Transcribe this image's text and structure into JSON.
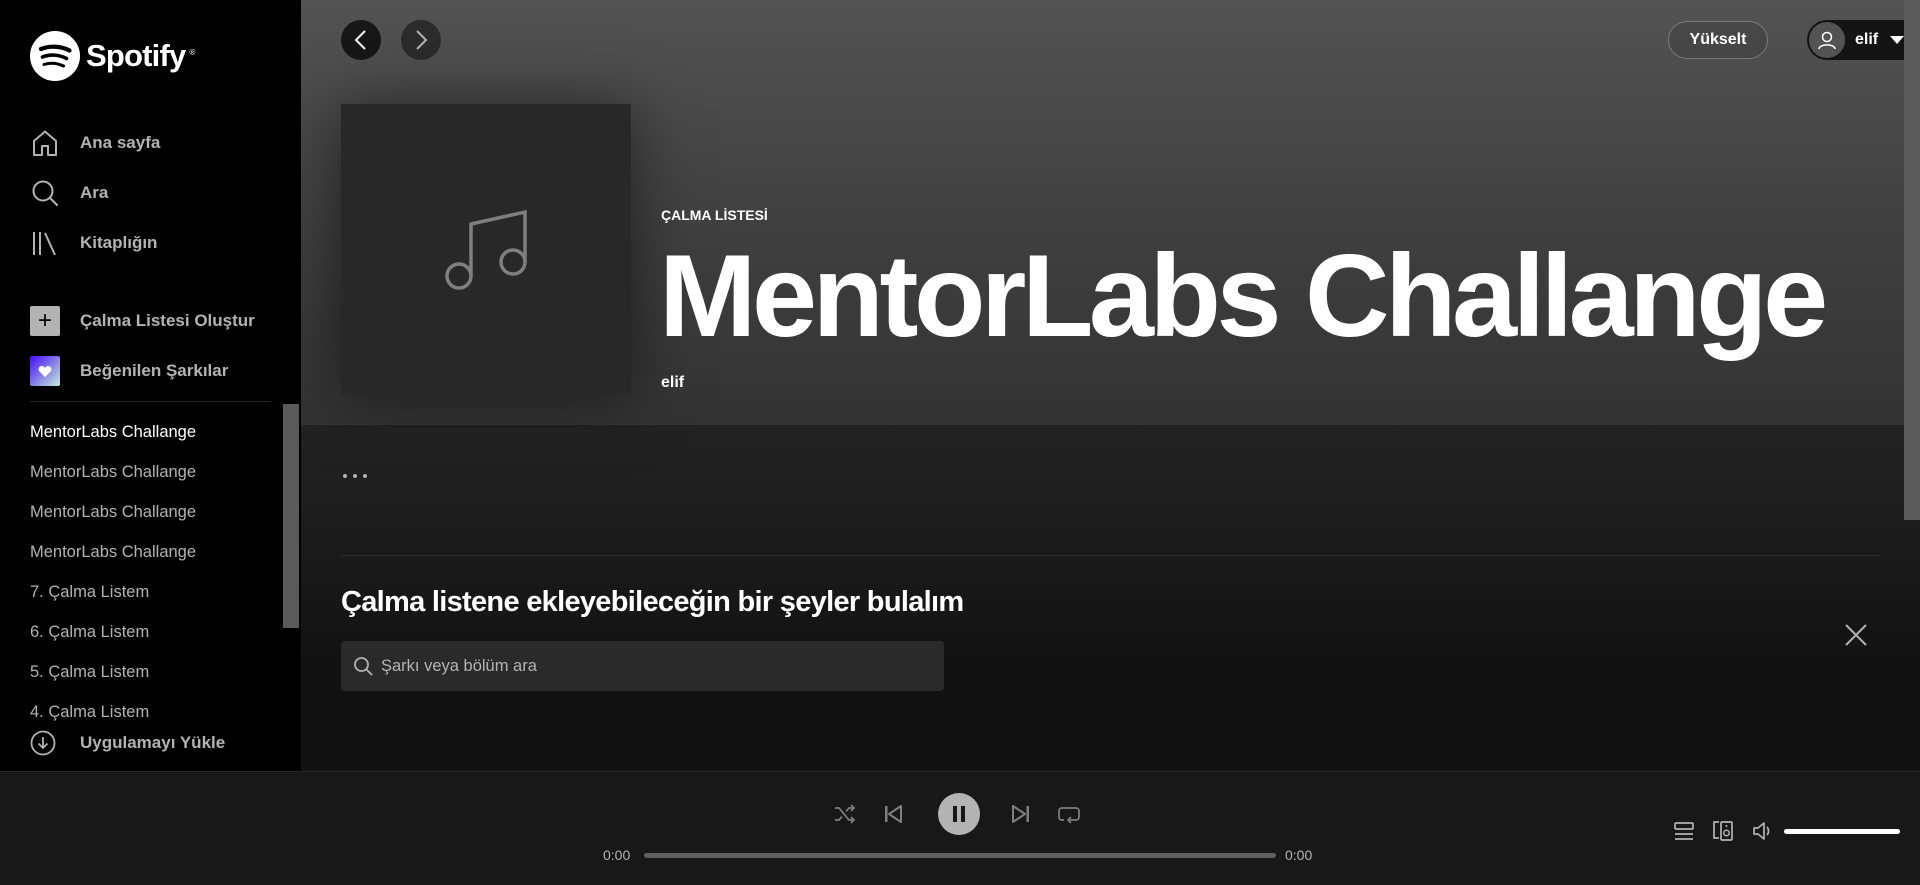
{
  "brand": {
    "name": "Spotify",
    "reg": "®"
  },
  "nav": [
    {
      "label": "Ana sayfa",
      "icon": "home-icon"
    },
    {
      "label": "Ara",
      "icon": "search-icon"
    },
    {
      "label": "Kitaplığın",
      "icon": "library-icon"
    }
  ],
  "actions": {
    "create_playlist": "Çalma Listesi Oluştur",
    "liked_songs": "Beğenilen Şarkılar"
  },
  "playlists": [
    "MentorLabs Challange",
    "MentorLabs Challange",
    "MentorLabs Challange",
    "MentorLabs Challange",
    "7. Çalma Listem",
    "6. Çalma Listem",
    "5. Çalma Listem",
    "4. Çalma Listem"
  ],
  "active_playlist_index": 0,
  "install_app": "Uygulamayı Yükle",
  "topbar": {
    "upgrade": "Yükselt",
    "username": "elif"
  },
  "header": {
    "type_label": "ÇALMA LİSTESİ",
    "title": "MentorLabs Challange",
    "owner": "elif"
  },
  "find": {
    "title": "Çalma listene ekleyebileceğin bir şeyler bulalım",
    "search_placeholder": "Şarkı veya bölüm ara"
  },
  "player": {
    "current_time": "0:00",
    "total_time": "0:00",
    "progress": 0,
    "volume": 1.0,
    "is_playing": true
  },
  "colors": {
    "background": "#121212",
    "sidebar": "#000000",
    "player": "#181818",
    "text_muted": "#b3b3b3"
  }
}
